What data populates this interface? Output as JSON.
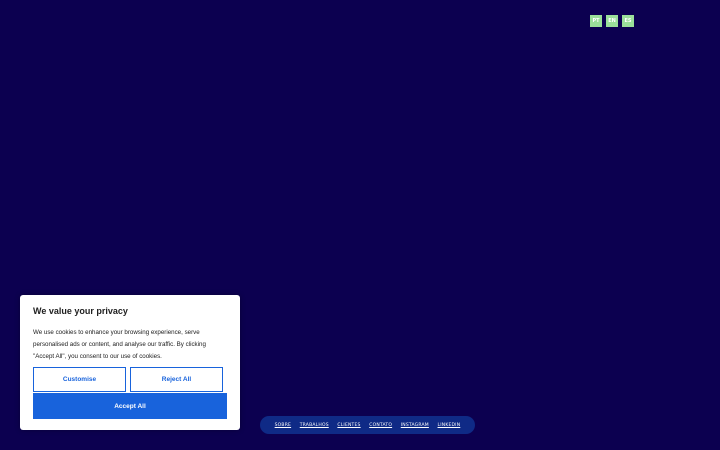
{
  "colors": {
    "background": "#0c0050",
    "lang_button": "#9be09a",
    "accent": "#1863dc",
    "nav_pill": "#0f2a86"
  },
  "language_switcher": {
    "items": [
      {
        "label": "PT"
      },
      {
        "label": "EN"
      },
      {
        "label": "ES"
      }
    ]
  },
  "cookie_banner": {
    "title": "We value your privacy",
    "body": "We use cookies to enhance your browsing experience, serve personalised ads or content, and analyse our traffic. By clicking \"Accept All\", you consent to our use of cookies.",
    "customise_label": "Customise",
    "reject_label": "Reject All",
    "accept_label": "Accept All"
  },
  "footer_nav": {
    "items": [
      {
        "label": "SOBRE"
      },
      {
        "label": "TRABALHOS"
      },
      {
        "label": "CLIENTES"
      },
      {
        "label": "CONTATO"
      },
      {
        "label": "INSTAGRAM"
      },
      {
        "label": "LINKEDIN"
      }
    ]
  }
}
